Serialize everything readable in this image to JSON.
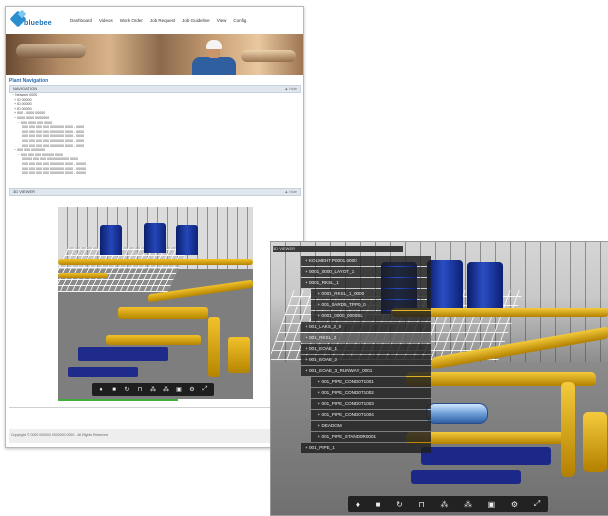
{
  "app": {
    "logo_text": "bluebee"
  },
  "nav": [
    "Dashboard",
    "Videos",
    "Work Order",
    "Job Request",
    "Job Guideline",
    "View",
    "Config"
  ],
  "page": {
    "section_title": "Plant Navigation",
    "panel_1_title": "NAVIGATION",
    "panel_1_collapse": "▲ hide",
    "panel_2_title": "3D VIEWER",
    "panel_2_collapse": "▲ hide",
    "tree_rows": [
      "− Network 0000",
      "  + ID 00000",
      "  + ID 00000",
      "  + ID 00000",
      "  + 000 - 0000 00000",
      "  − 0000 0000 0000000",
      "      − 000 0000 000 0000",
      "          000 000 000 000 0000000 0000 - 0000",
      "          000 000 000 000 0000000 0000 - 0000",
      "          000 000 000 000 0000000 0000 - 0000",
      "          000 000 000 000 0000000 0000 - 0000",
      "          000 000 000 000 0000000 0000 - 0000",
      "  − 000 000 0000000",
      "      − 000 000 000 000000 0000",
      "          00000 000 000 00000000000 0000",
      "          000 000 000 000 0000000 0000 - 00000",
      "          000 000 000 000 0000000 0000 - 00000",
      "          000 000 000 000 0000000 0000 - 00000"
    ],
    "footer_text": "Copyright © 0000 000000 0000000 0000 - All Rights Reserved"
  },
  "zoom_viewer": {
    "header": "3D VIEWER",
    "tree": [
      "+ KOLMEHT.P0001.0000",
      "+ 0001_0000_LAYOT_1",
      "+ 0001_RKSL_1",
      "  + 0001_RKSL_1_0000",
      "  + 001_0ARD5_TPP0_0",
      "  + 0001_0000_0000SL",
      "+ 001_LAKS_2_0",
      "+ 001_RKSL_2",
      "+ 001_EOAE_1",
      "+ 001_EOAE_2",
      "+ 001_EOAE_3_RUNWAY_0001",
      "  + 001_PIPE_COND0T1001",
      "  + 001_PIPE_COND0T1002",
      "  + 001_PIPE_COND0T1003",
      "  + 001_PIPE_COND0T1004",
      "  + DEADOM",
      "  + 001_PIPE_STAND0R0001",
      "+ 001_PIPE_1"
    ]
  },
  "toolbar_icons": [
    "walk-icon",
    "camera-icon",
    "rotate-icon",
    "measure-icon",
    "tree-icon",
    "structure-icon",
    "save-icon",
    "settings-icon",
    "fullscreen-icon"
  ],
  "toolbar_glyphs": [
    "♦",
    "■",
    "↻",
    "⊓",
    "⁂",
    "⁂",
    "▣",
    "⚙",
    "⤢"
  ]
}
